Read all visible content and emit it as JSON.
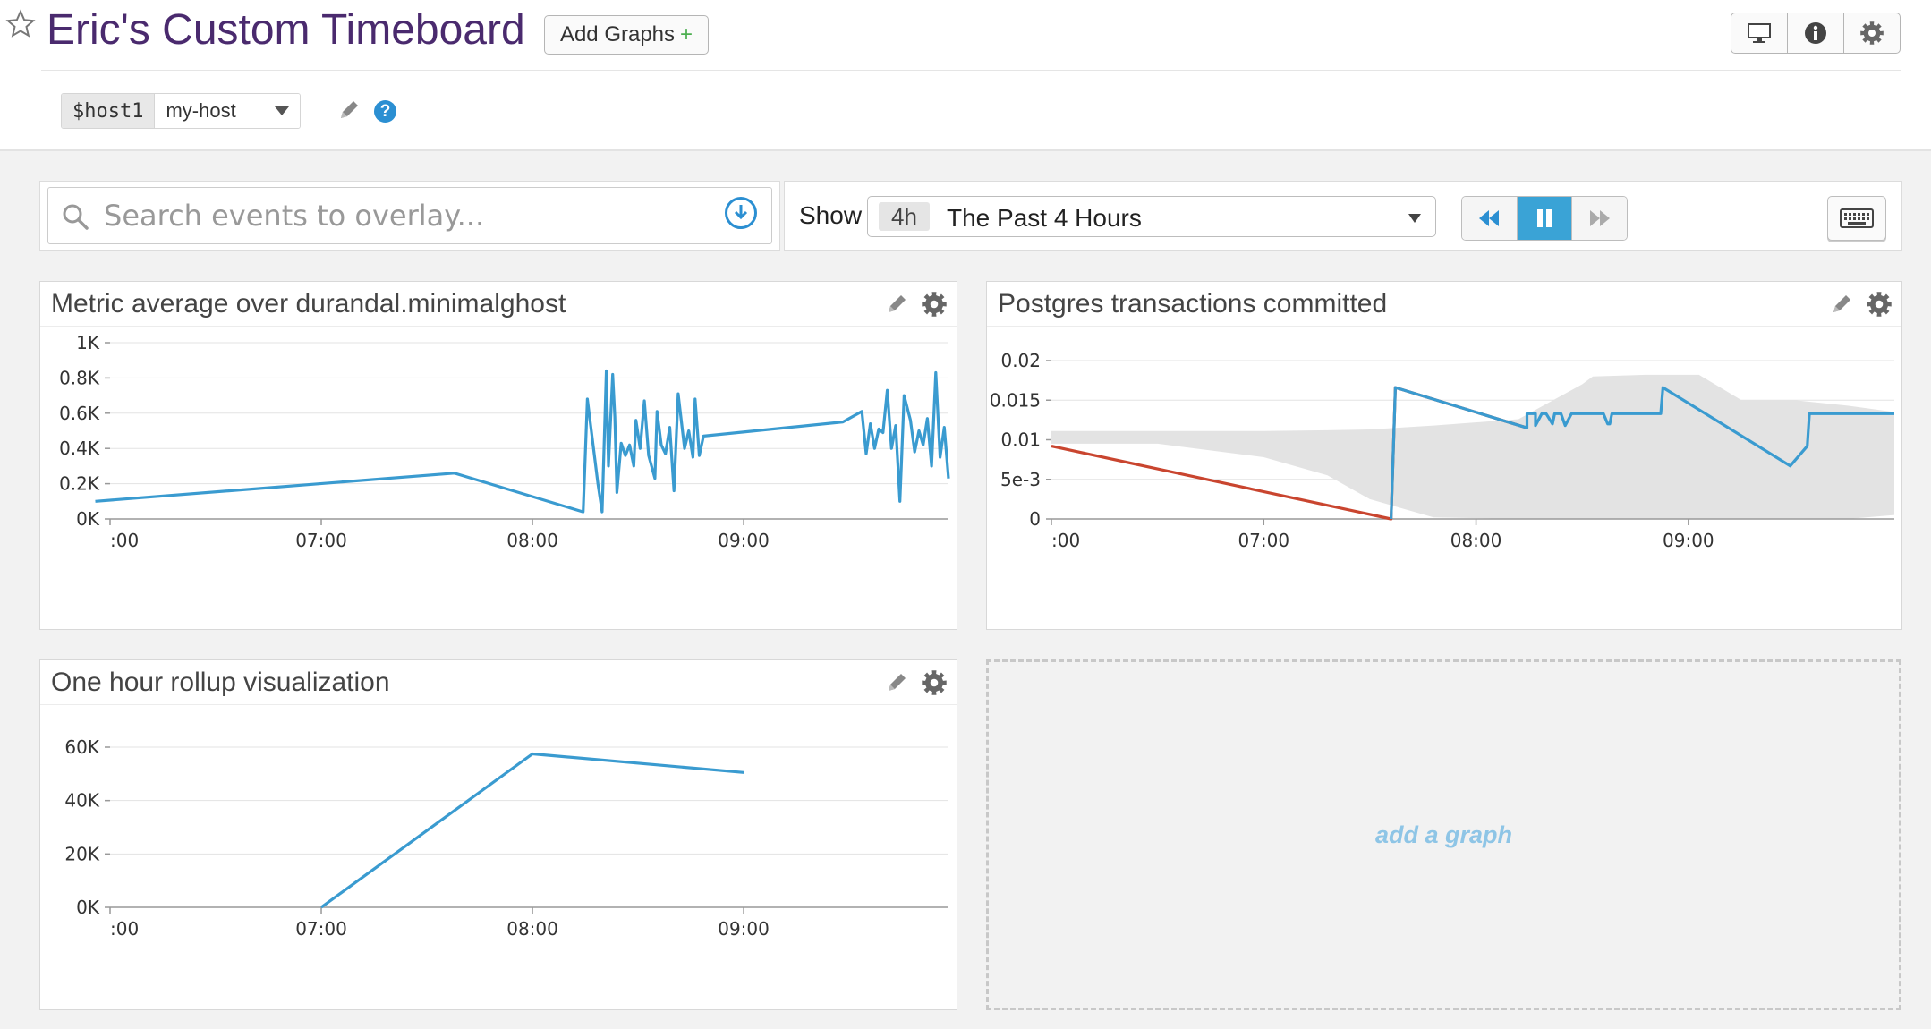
{
  "header": {
    "title": "Eric's Custom Timeboard",
    "add_graphs_label": "Add Graphs",
    "add_graphs_plus": "+",
    "buttons": [
      "monitor-icon",
      "info-icon",
      "gear-icon"
    ]
  },
  "template_var": {
    "name": "$host1",
    "value": "my-host",
    "help": "?"
  },
  "toolbar": {
    "search_placeholder": "Search events to overlay...",
    "clear": "×",
    "show_label": "Show",
    "time_short": "4h",
    "time_label": "The Past 4 Hours",
    "playback": [
      "rewind-icon",
      "pause-icon",
      "fast-forward-icon"
    ],
    "active_playback": "pause-icon"
  },
  "colors": {
    "accent": "#3a9bd0",
    "series_red": "#c9452f",
    "band": "#e3e3e3",
    "title_purple": "#4a2a6e"
  },
  "widgets": {
    "metric_avg": {
      "title": "Metric average over durandal.minimalghost"
    },
    "postgres": {
      "title": "Postgres transactions committed"
    },
    "rollup": {
      "title": "One hour rollup visualization"
    },
    "add_graph": "add a graph"
  },
  "chart_data": [
    {
      "type": "line",
      "title": "Metric average over durandal.minimalghost",
      "x_ticks": [
        ":00",
        "07:00",
        "08:00",
        "09:00"
      ],
      "x_tick_pos": [
        6,
        7,
        8,
        9
      ],
      "xlim": [
        6,
        9.97
      ],
      "y_ticks": [
        "0K",
        "0.2K",
        "0.4K",
        "0.6K",
        "0.8K",
        "1K"
      ],
      "ylim": [
        0,
        1000
      ],
      "grid": true,
      "series": [
        {
          "color": "#3a9bd0",
          "x": [
            5.93,
            7.63,
            8.24,
            8.26,
            8.31,
            8.33,
            8.35,
            8.36,
            8.38,
            8.39,
            8.4,
            8.42,
            8.44,
            8.46,
            8.48,
            8.49,
            8.51,
            8.53,
            8.55,
            8.58,
            8.59,
            8.61,
            8.63,
            8.65,
            8.67,
            8.69,
            8.72,
            8.74,
            8.76,
            8.77,
            8.79,
            8.81,
            9.47,
            9.56,
            9.58,
            9.6,
            9.62,
            9.64,
            9.66,
            9.68,
            9.7,
            9.72,
            9.74,
            9.76,
            9.79,
            9.81,
            9.83,
            9.85,
            9.87,
            9.89,
            9.91,
            9.93,
            9.95,
            9.97
          ],
          "y": [
            100,
            260,
            40,
            680,
            200,
            40,
            840,
            300,
            820,
            580,
            150,
            430,
            360,
            420,
            300,
            560,
            400,
            670,
            360,
            230,
            610,
            420,
            370,
            520,
            160,
            710,
            400,
            500,
            350,
            680,
            360,
            470,
            550,
            610,
            370,
            540,
            400,
            510,
            490,
            730,
            400,
            530,
            100,
            700,
            560,
            380,
            500,
            420,
            570,
            300,
            830,
            350,
            520,
            230
          ]
        }
      ]
    },
    {
      "type": "line",
      "title": "Postgres transactions committed",
      "x_ticks": [
        ":00",
        "07:00",
        "08:00",
        "09:00"
      ],
      "x_tick_pos": [
        6,
        7,
        8,
        9
      ],
      "xlim": [
        6,
        9.97
      ],
      "y_ticks": [
        "0",
        "5e-3",
        "0.01",
        "0.015",
        "0.02"
      ],
      "ylim": [
        0,
        0.02
      ],
      "grid": true,
      "band": {
        "x": [
          6,
          6.5,
          7,
          7.3,
          7.5,
          7.8,
          8.2,
          8.5,
          8.55,
          8.8,
          9.05,
          9.25,
          9.5,
          9.75,
          9.97
        ],
        "upper": [
          0.0111,
          0.0111,
          0.0111,
          0.0112,
          0.0113,
          0.0118,
          0.0126,
          0.017,
          0.018,
          0.0182,
          0.0182,
          0.015,
          0.015,
          0.0143,
          0.0135
        ],
        "lower": [
          0.0095,
          0.0095,
          0.0078,
          0.0055,
          0.0025,
          0.0002,
          0,
          0,
          0,
          0,
          0,
          0,
          0,
          0,
          0.0005
        ]
      },
      "series": [
        {
          "color": "#c9452f",
          "x": [
            6,
            7.6,
            7.62,
            8.24
          ],
          "y": [
            0.0092,
            0,
            0.0166,
            0.0115
          ]
        },
        {
          "color": "#3a9bd0",
          "x": [
            7.6,
            7.62,
            8.24,
            8.24,
            8.28,
            8.28,
            8.31,
            8.33,
            8.36,
            8.37,
            8.4,
            8.42,
            8.45,
            8.46,
            8.6,
            8.62,
            8.63,
            8.64,
            8.87,
            8.88,
            9.48,
            9.56,
            9.57,
            9.97
          ],
          "y": [
            0,
            0.0166,
            0.0115,
            0.0133,
            0.0133,
            0.0118,
            0.0133,
            0.0133,
            0.012,
            0.0133,
            0.0133,
            0.0118,
            0.0133,
            0.0133,
            0.0133,
            0.012,
            0.012,
            0.0133,
            0.0133,
            0.0166,
            0.0067,
            0.0092,
            0.0133,
            0.0133
          ]
        }
      ]
    },
    {
      "type": "line",
      "title": "One hour rollup visualization",
      "x_ticks": [
        ":00",
        "07:00",
        "08:00",
        "09:00"
      ],
      "x_tick_pos": [
        6,
        7,
        8,
        9
      ],
      "xlim": [
        6,
        9.97
      ],
      "y_ticks": [
        "0K",
        "20K",
        "40K",
        "60K"
      ],
      "ylim": [
        0,
        60000
      ],
      "grid": true,
      "series": [
        {
          "color": "#3a9bd0",
          "x": [
            7,
            8,
            9
          ],
          "y": [
            0,
            57500,
            50500
          ]
        }
      ]
    }
  ]
}
